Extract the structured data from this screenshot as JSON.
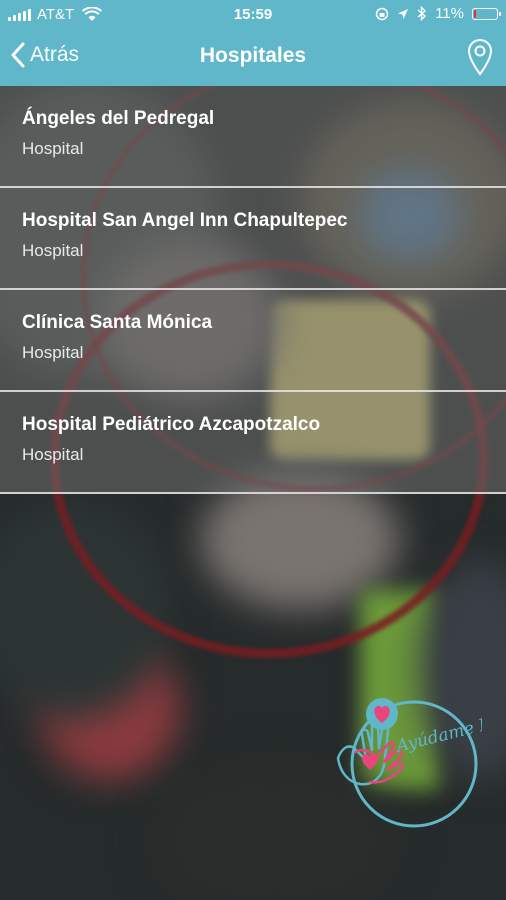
{
  "status_bar": {
    "carrier": "AT&T",
    "time": "15:59",
    "battery_percent": "11%",
    "battery_level": 0.11,
    "icons": [
      "signal-icon",
      "wifi-icon",
      "screen-lock-icon",
      "location-arrow-icon",
      "bluetooth-icon",
      "battery-icon"
    ]
  },
  "nav": {
    "back_label": "Atrás",
    "title": "Hospitales",
    "action_icon": "map-pin-icon"
  },
  "list": {
    "items": [
      {
        "title": "Ángeles del Pedregal",
        "subtitle": "Hospital"
      },
      {
        "title": "Hospital San Angel Inn Chapultepec",
        "subtitle": "Hospital"
      },
      {
        "title": "Clínica Santa Mónica",
        "subtitle": "Hospital"
      },
      {
        "title": "Hospital Pediátrico Azcapotzalco",
        "subtitle": "Hospital"
      }
    ]
  },
  "logo": {
    "text": "Ayúdame Ma!",
    "colors": {
      "ring": "#5fb7c9",
      "heart": "#e8457e",
      "text": "#5fb7c9"
    }
  },
  "colors": {
    "header": "#5fb7c9",
    "row_overlay": "rgba(110,110,110,0.55)",
    "separator": "#e6e6e6"
  }
}
